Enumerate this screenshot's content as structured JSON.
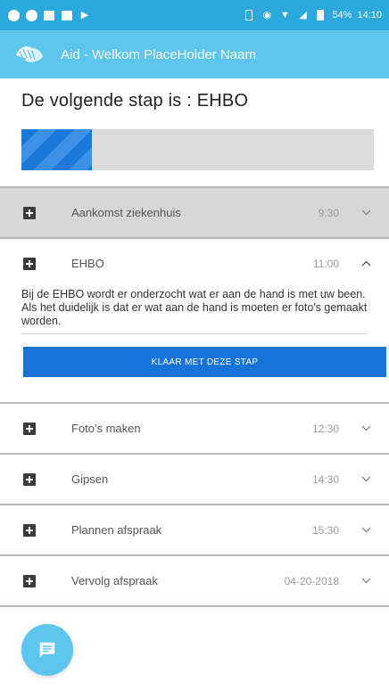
{
  "status_bar": {
    "battery": "54%",
    "time": "14:10"
  },
  "app_bar": {
    "title": "Aid - Welkom PlaceHolder Naam"
  },
  "next_step": {
    "title": "De volgende stap is : EHBO",
    "progress": 0.2
  },
  "steps": [
    {
      "name": "Aankomst ziekenhuis",
      "time": "9:30",
      "state": "done"
    },
    {
      "name": "EHBO",
      "time": "11:00",
      "state": "expanded",
      "description": "Bij de EHBO wordt er onderzocht wat er aan de hand is met uw been. Als het duidelijk is dat er wat aan de hand is moeten er foto's gemaakt worden.",
      "action": "KLAAR MET DEZE STAP"
    },
    {
      "name": "Foto's maken",
      "time": "12:30",
      "state": "collapsed"
    },
    {
      "name": "Gipsen",
      "time": "14:30",
      "state": "collapsed"
    },
    {
      "name": "Plannen afspraak",
      "time": "15:30",
      "state": "collapsed"
    },
    {
      "name": "Vervolg afspraak",
      "time": "04-20-2018",
      "state": "collapsed"
    }
  ],
  "colors": {
    "status_bar": "#2ba8dc",
    "app_bar": "#5ec6ee",
    "action_button": "#1673d9",
    "progress_track": "#dcdcdc"
  },
  "icons": {
    "fab": "chat-icon",
    "step": "plus-box-icon",
    "collapsed": "chevron-down-icon",
    "expanded": "chevron-up-icon"
  }
}
